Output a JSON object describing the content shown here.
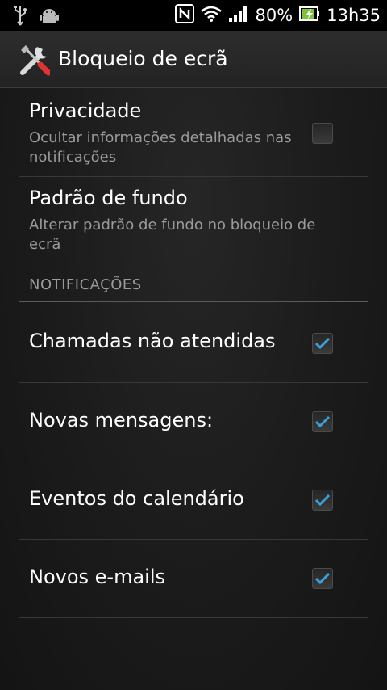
{
  "status_bar": {
    "battery_percent": "80%",
    "time": "13h35",
    "icons": [
      "usb-icon",
      "android-debug-icon",
      "nfc-icon",
      "wifi-icon",
      "signal-icon",
      "battery-charging-icon"
    ]
  },
  "action_bar": {
    "title": "Bloqueio de ecrã",
    "icon": "tools-icon"
  },
  "settings": {
    "privacy": {
      "title": "Privacidade",
      "summary": "Ocultar informações detalhadas nas notificações",
      "checked": false
    },
    "background_pattern": {
      "title": "Padrão de fundo",
      "summary": "Alterar padrão de fundo no bloqueio de ecrã"
    }
  },
  "notifications_section": {
    "header": "NOTIFICAÇÕES",
    "items": [
      {
        "label": "Chamadas não atendidas",
        "checked": true
      },
      {
        "label": "Novas mensagens:",
        "checked": true
      },
      {
        "label": "Eventos do calendário",
        "checked": true
      },
      {
        "label": "Novos e-mails",
        "checked": true
      }
    ]
  },
  "colors": {
    "check_accent": "#3aa0d8",
    "background": "#1a1a1a",
    "secondary_text": "#9a9a9a"
  }
}
